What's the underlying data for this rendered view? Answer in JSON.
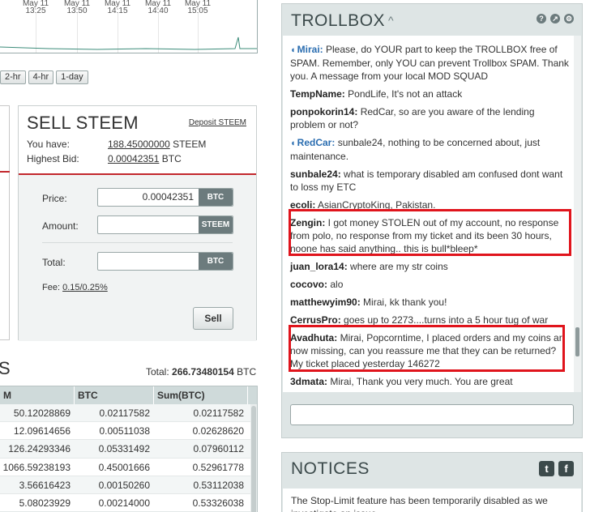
{
  "chart": {
    "ticks": [
      {
        "top": "May 11",
        "bottom": "13:25"
      },
      {
        "top": "May 11",
        "bottom": "13:50"
      },
      {
        "top": "May 11",
        "bottom": "14:15"
      },
      {
        "top": "May 11",
        "bottom": "14:40"
      },
      {
        "top": "May 11",
        "bottom": "15:05"
      }
    ]
  },
  "zoom": [
    "2-hr",
    "4-hr",
    "1-day"
  ],
  "sell": {
    "title": "SELL STEEM",
    "deposit_link": "Deposit STEEM",
    "you_have_label": "You have:",
    "you_have_value": "188.45000000",
    "you_have_unit": "STEEM",
    "highest_bid_label": "Highest Bid:",
    "highest_bid_value": "0.00042351",
    "highest_bid_unit": "BTC",
    "price_label": "Price:",
    "price_value": "0.00042351",
    "price_unit": "BTC",
    "amount_label": "Amount:",
    "amount_value": "",
    "amount_unit": "STEEM",
    "total_label": "Total:",
    "total_value": "",
    "total_unit": "BTC",
    "fee_label": "Fee:",
    "fee_value": "0.15/0.25%",
    "sell_button": "Sell"
  },
  "orders": {
    "heading_fragment": "S",
    "total_label": "Total:",
    "total_value": "266.73480154",
    "total_unit": "BTC",
    "columns": [
      "M",
      "BTC",
      "Sum(BTC)"
    ],
    "rows": [
      [
        "50.12028869",
        "0.02117582",
        "0.02117582"
      ],
      [
        "12.09614656",
        "0.00511038",
        "0.02628620"
      ],
      [
        "126.24293346",
        "0.05331492",
        "0.07960112"
      ],
      [
        "1066.59238193",
        "0.45001666",
        "0.52961778"
      ],
      [
        "3.56616423",
        "0.00150260",
        "0.53112038"
      ],
      [
        "5.08023929",
        "0.00214000",
        "0.53326038"
      ]
    ]
  },
  "trollbox": {
    "title": "TROLLBOX",
    "caret": "^",
    "icons": [
      "?",
      "↗",
      "⚙"
    ],
    "messages": [
      {
        "user": "Mirai:",
        "mod": true,
        "text": "Please, do YOUR part to keep the TROLLBOX free of SPAM. Remember, only YOU can prevent Trollbox SPAM. Thank you. A message from your local MOD SQUAD"
      },
      {
        "user": "TempName:",
        "mod": false,
        "text": "PondLife, It's not an attack"
      },
      {
        "user": "ponpokorin14:",
        "mod": false,
        "text": "RedCar, so are you aware of the lending problem or not?"
      },
      {
        "user": "RedCar:",
        "mod": true,
        "text": "sunbale24, nothing to be concerned about, just maintenance."
      },
      {
        "user": "sunbale24:",
        "mod": false,
        "text": "what is temporary disabled am confused dont want to loss my ETC"
      },
      {
        "user": "ecoli:",
        "mod": false,
        "text": "AsianCryptoKing, Pakistan."
      },
      {
        "user": "Zengin:",
        "mod": false,
        "text": "I got money STOLEN out of my account, no response from polo, no response from my ticket and its been 30 hours, noone has said anything.. this is bull*bleep*"
      },
      {
        "user": "juan_lora14:",
        "mod": false,
        "text": "where are my str coins"
      },
      {
        "user": "cocovo:",
        "mod": false,
        "text": "alo"
      },
      {
        "user": "matthewyim90:",
        "mod": false,
        "text": "Mirai, kk thank you!"
      },
      {
        "user": "CerrusPro:",
        "mod": false,
        "text": "goes up to 2273....turns into a 5 hour tug of war"
      },
      {
        "user": "Avadhuta:",
        "mod": false,
        "text": "Mirai, Popcorntime, I placed orders and my coins ar now missing, can you reassure me that they can be returned? My ticket placed yesterday 146272"
      },
      {
        "user": "3dmata:",
        "mod": false,
        "text": "Mirai, Thank you very much. You are great"
      }
    ],
    "input_value": ""
  },
  "notices": {
    "title": "NOTICES",
    "social": [
      "t",
      "f"
    ],
    "text": "The Stop-Limit feature has been temporarily disabled as we investigate an issue."
  },
  "colors": {
    "accent_red": "#c2272d",
    "highlight_red": "#e0141c",
    "panel_bg": "#dee5e5",
    "mod_blue": "#2a6db0"
  }
}
